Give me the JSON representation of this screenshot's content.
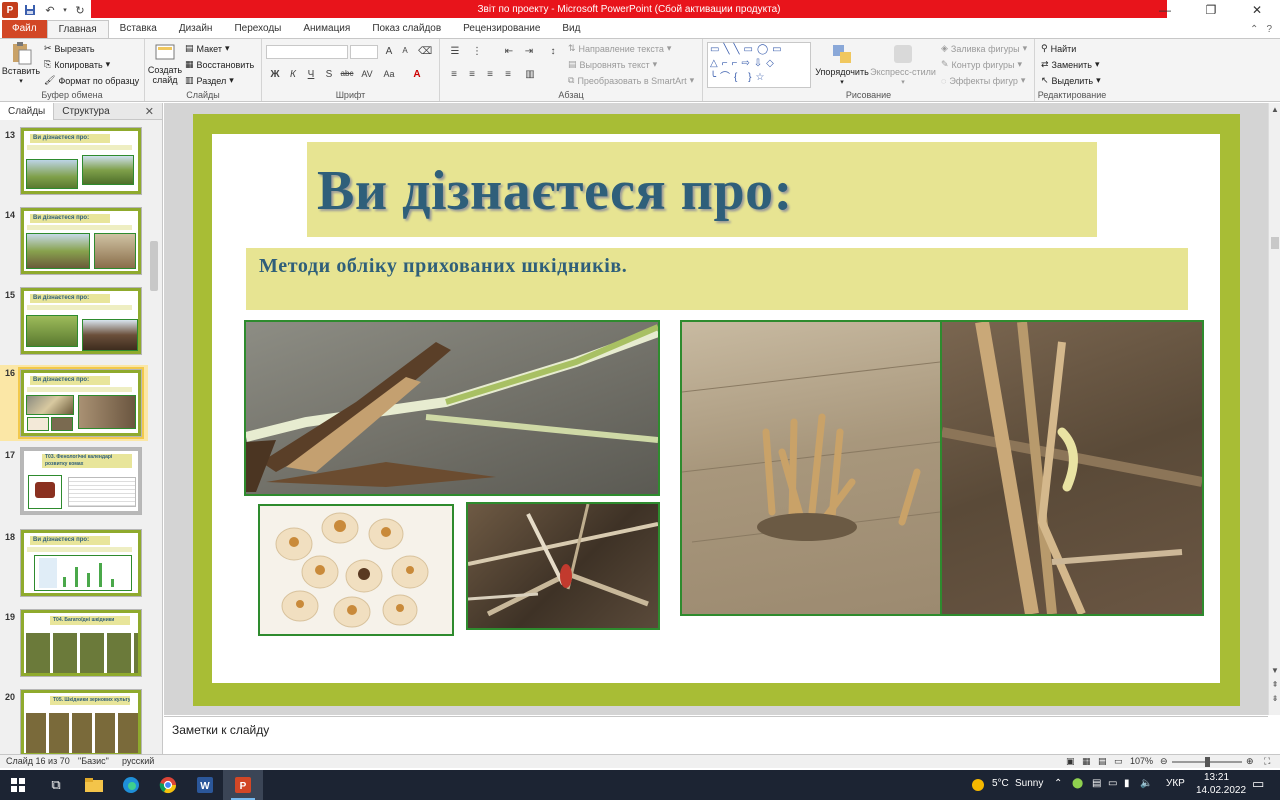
{
  "window": {
    "title": "Звіт по проекту  -  Microsoft PowerPoint (Сбой активации продукта)",
    "app_icon": "P",
    "controls": [
      "minimize-icon",
      "restore-icon",
      "close-icon"
    ]
  },
  "ribbon_tabs": [
    "Файл",
    "Главная",
    "Вставка",
    "Дизайн",
    "Переходы",
    "Анимация",
    "Показ слайдов",
    "Рецензирование",
    "Вид"
  ],
  "active_tab": "Главная",
  "ribbon": {
    "clipboard": {
      "paste": "Вставить",
      "cut": "Вырезать",
      "copy": "Копировать",
      "format_painter": "Формат по образцу",
      "label": "Буфер обмена"
    },
    "slides": {
      "new_slide": "Создать слайд",
      "layout": "Макет",
      "reset": "Восстановить",
      "section": "Раздел",
      "label": "Слайды"
    },
    "font": {
      "label": "Шрифт",
      "buttons": [
        "Ж",
        "К",
        "Ч",
        "S",
        "abc",
        "AV",
        "Aa",
        "A"
      ]
    },
    "paragraph": {
      "text_direction": "Направление текста",
      "align_text": "Выровнять текст",
      "smartart": "Преобразовать в SmartArt",
      "label": "Абзац"
    },
    "drawing": {
      "arrange": "Упорядочить",
      "quick_styles": "Экспресс-стили",
      "shape_fill": "Заливка фигуры",
      "shape_outline": "Контур фигуры",
      "shape_effects": "Эффекты фигур",
      "label": "Рисование"
    },
    "editing": {
      "find": "Найти",
      "replace": "Заменить",
      "select": "Выделить",
      "label": "Редактирование"
    }
  },
  "panel": {
    "tabs": [
      "Слайды",
      "Структура"
    ],
    "close": "✕",
    "thumbnails": [
      {
        "num": "13",
        "title": "Ви дізнаєтеся про:"
      },
      {
        "num": "14",
        "title": "Ви дізнаєтеся про:"
      },
      {
        "num": "15",
        "title": "Ви дізнаєтеся про:"
      },
      {
        "num": "16",
        "title": "Ви дізнаєтеся про:"
      },
      {
        "num": "17",
        "title": "Т03. Фенологічні календарі розвитку комах"
      },
      {
        "num": "18",
        "title": "Ви дізнаєтеся про:"
      },
      {
        "num": "19",
        "title": "Т04. Багатоїдні шкідники"
      },
      {
        "num": "20",
        "title": "Т05. Шкідники зернових культур"
      }
    ]
  },
  "slide": {
    "title": "Ви дізнаєтеся про:",
    "subtitle": "Методи обліку прихованих шкідників.",
    "colors": {
      "frame": "#a8bd35",
      "title_bg": "#e7e492",
      "title_text": "#2f5f7a",
      "photo_border": "#2e8b2e"
    }
  },
  "notes": {
    "placeholder": "Заметки к слайду"
  },
  "statusbar": {
    "slide_pos": "Слайд 16 из 70",
    "theme": "\"Базис\"",
    "language": "русский",
    "zoom": "107%"
  },
  "taskbar": {
    "weather_temp": "5°C",
    "weather_desc": "Sunny",
    "lang": "УКР",
    "time": "13:21",
    "date": "14.02.2022"
  }
}
